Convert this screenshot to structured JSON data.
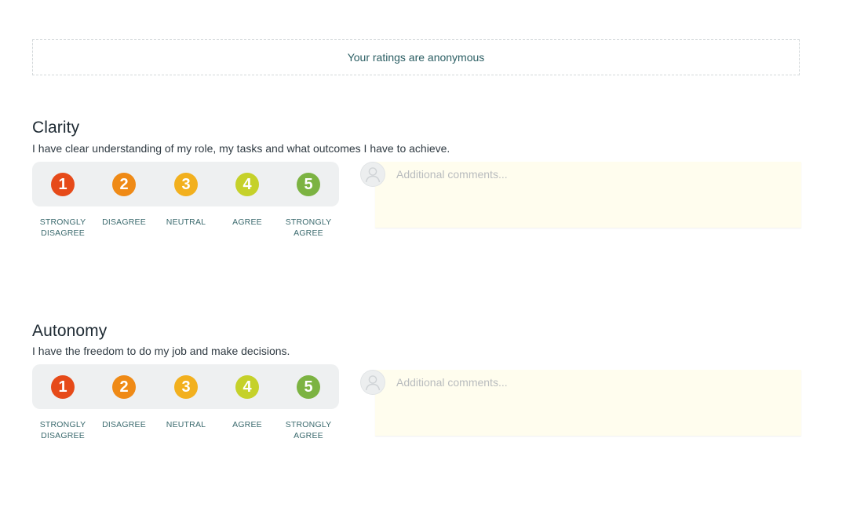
{
  "banner": {
    "text": "Your ratings are anonymous"
  },
  "scale_options": [
    {
      "number": "1",
      "label": "Strongly Disagree",
      "color": "#e64a19"
    },
    {
      "number": "2",
      "label": "Disagree",
      "color": "#ef8a16"
    },
    {
      "number": "3",
      "label": "Neutral",
      "color": "#f2b01e"
    },
    {
      "number": "4",
      "label": "Agree",
      "color": "#c5d12a"
    },
    {
      "number": "5",
      "label": "Strongly Agree",
      "color": "#7cb342"
    }
  ],
  "questions": [
    {
      "title": "Clarity",
      "description": "I have clear understanding of my role, my tasks and what outcomes I have to achieve.",
      "comment_placeholder": "Additional comments..."
    },
    {
      "title": "Autonomy",
      "description": "I have the freedom to do my job and make decisions.",
      "comment_placeholder": "Additional comments..."
    }
  ]
}
